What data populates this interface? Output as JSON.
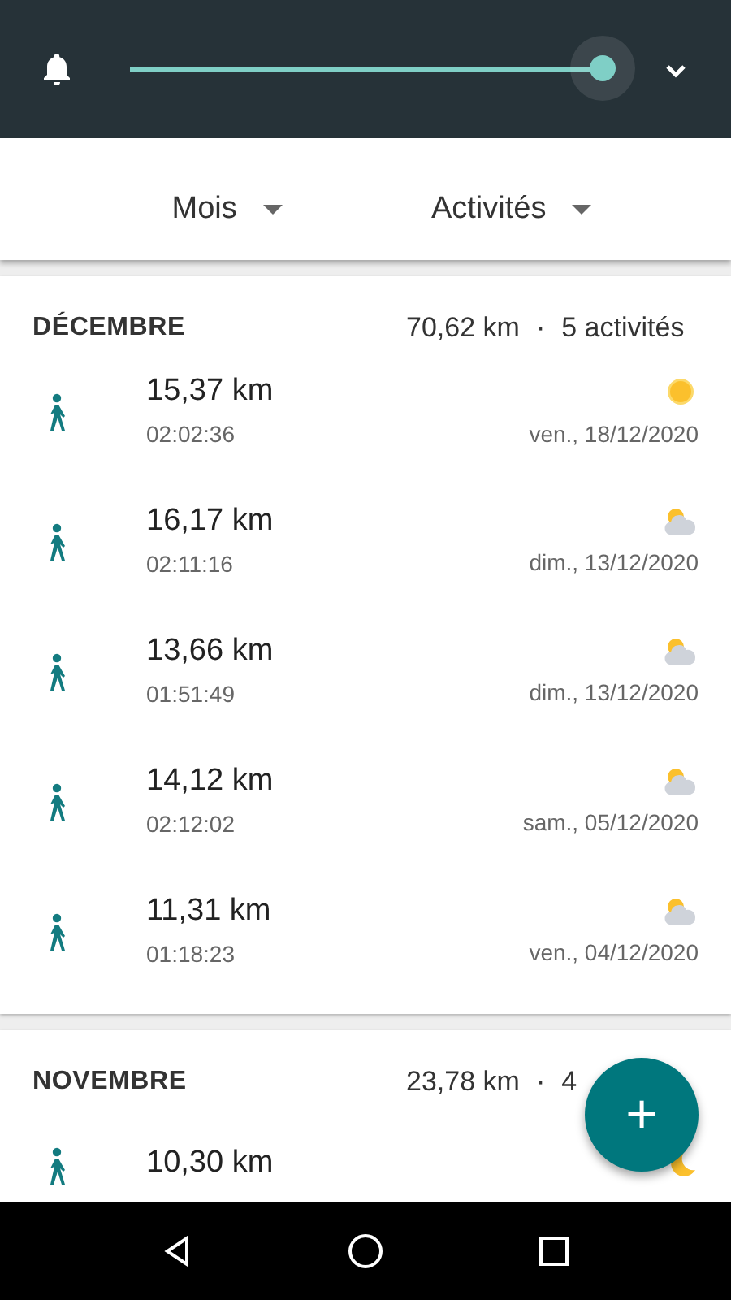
{
  "header": {
    "slider": {
      "level": 1.0
    }
  },
  "filters": [
    {
      "label": "Mois"
    },
    {
      "label": "Activités"
    }
  ],
  "months": [
    {
      "title": "DÉCEMBRE",
      "distance": "70,62 km",
      "separator": "·",
      "count": "5 activités",
      "activities": [
        {
          "distance": "15,37 km",
          "duration": "02:02:36",
          "date": "ven., 18/12/2020",
          "kind": "sunny"
        },
        {
          "distance": "16,17 km",
          "duration": "02:11:16",
          "date": "dim., 13/12/2020",
          "kind": "partly-cloudy"
        },
        {
          "distance": "13,66 km",
          "duration": "01:51:49",
          "date": "dim., 13/12/2020",
          "kind": "partly-cloudy"
        },
        {
          "distance": "14,12 km",
          "duration": "02:12:02",
          "date": "sam., 05/12/2020",
          "kind": "partly-cloudy"
        },
        {
          "distance": "11,31 km",
          "duration": "01:18:23",
          "date": "ven., 04/12/2020",
          "kind": "partly-cloudy"
        }
      ]
    },
    {
      "title": "NOVEMBRE",
      "distance": "23,78 km",
      "separator": "·",
      "count": "4",
      "activities": [
        {
          "distance": "10,30 km",
          "kind": "night"
        }
      ]
    }
  ],
  "fab": {
    "label": "+"
  }
}
